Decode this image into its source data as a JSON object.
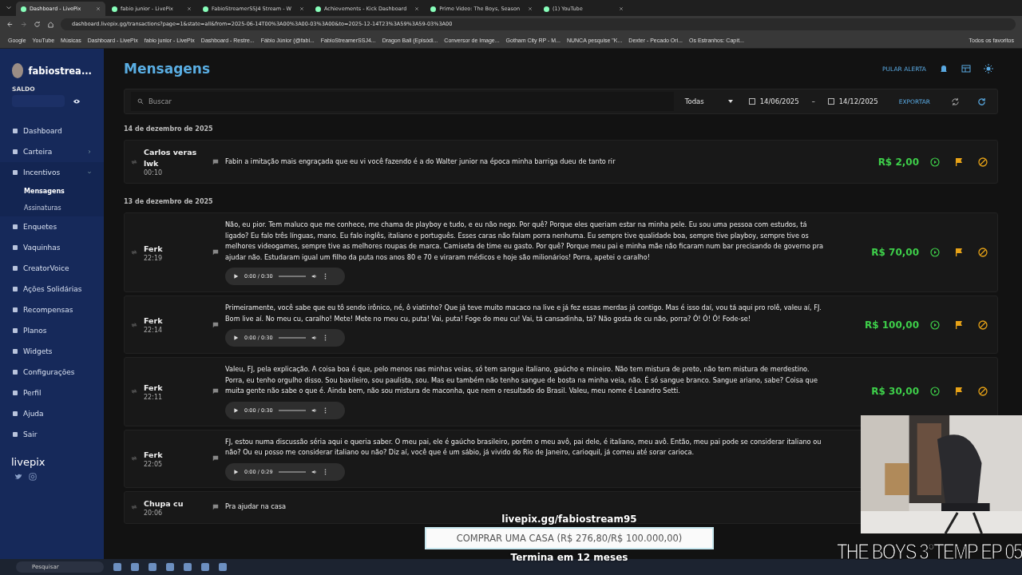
{
  "browser": {
    "tabs": [
      {
        "title": "Dashboard - LivePix",
        "selected": true
      },
      {
        "title": "fabio junior - LivePix",
        "selected": false
      },
      {
        "title": "FabioStreamerSSJ4 Stream - W",
        "selected": false
      },
      {
        "title": "Achievements - Kick Dashboard",
        "selected": false
      },
      {
        "title": "Prime Video: The Boys, Season",
        "selected": false
      },
      {
        "title": "(1) YouTube",
        "selected": false
      }
    ],
    "url": "dashboard.livepix.gg/transactions?page=1&state=all&from=2025-06-14T00%3A00%3A00-03%3A00&to=2025-12-14T23%3A59%3A59-03%3A00",
    "bookmarks": [
      "Google",
      "YouTube",
      "Músicas",
      "Dashboard - LivePix",
      "fabio junior - LivePix",
      "Dashboard - Restre...",
      "Fábio Júnior (@fabi...",
      "FabioStreamerSSJ4...",
      "Dragon Ball (Episódi...",
      "Conversor de Image...",
      "Gotham City RP - M...",
      "NUNCA pesquise \"K...",
      "Dexter - Pecado Ori...",
      "Os Estranhos: Capít..."
    ],
    "all_bookmarks": "Todos os favoritos"
  },
  "sidebar": {
    "user": "fabiostrea...",
    "balance_label": "SALDO",
    "logo": "livepix",
    "items": [
      {
        "label": "Dashboard",
        "selected": false
      },
      {
        "label": "Carteira",
        "selected": false,
        "expanded": false
      },
      {
        "label": "Incentivos",
        "selected": false,
        "expanded": true,
        "children": [
          {
            "label": "Mensagens",
            "selected": true
          },
          {
            "label": "Assinaturas",
            "selected": false
          }
        ]
      },
      {
        "label": "Enquetes",
        "selected": false
      },
      {
        "label": "Vaquinhas",
        "selected": false
      },
      {
        "label": "CreatorVoice",
        "selected": false
      },
      {
        "label": "Ações Solidárias",
        "selected": false
      },
      {
        "label": "Recompensas",
        "selected": false
      },
      {
        "label": "Planos",
        "selected": false
      },
      {
        "label": "Widgets",
        "selected": false
      },
      {
        "label": "Configurações",
        "selected": false
      },
      {
        "label": "Perfil",
        "selected": false
      },
      {
        "label": "Ajuda",
        "selected": false
      },
      {
        "label": "Sair",
        "selected": false
      }
    ]
  },
  "header": {
    "title": "Mensagens",
    "skip_alert": "PULAR ALERTA"
  },
  "filters": {
    "search_placeholder": "Buscar",
    "status": "Todas",
    "date_from": "14/06/2025",
    "date_to": "14/12/2025",
    "range_separator": "–",
    "export": "EXPORTAR"
  },
  "groups": [
    {
      "date": "14 de dezembro de 2025",
      "messages": [
        {
          "name": "Carlos veras lwk",
          "time": "00:10",
          "text": "Fabin a imitação mais engraçada que eu vi você fazendo é a do Walter junior na época minha barriga dueu de tanto rir",
          "amount": "R$ 2,00"
        }
      ]
    },
    {
      "date": "13 de dezembro de 2025",
      "messages": [
        {
          "name": "Ferk",
          "time": "22:19",
          "text": "Não, eu pior. Tem maluco que me conhece, me chama de playboy e tudo, e eu não nego. Por quê? Porque eles queriam estar na minha pele. Eu sou uma pessoa com estudos, tá ligado? Eu falo três línguas, mano. Eu falo inglês, italiano e português. Esses caras não falam porra nenhuma. Eu sempre tive qualidade boa, sempre tive playboy, sempre tive os melhores videogames, sempre tive as melhores roupas de marca. Camiseta de time eu gasto. Por quê? Porque meu pai e minha mãe não ficaram num bar precisando de governo pra ajudar não. Estudaram igual um filho da puta nos anos 80 e 70 e viraram médicos e hoje são milionários! Porra, apetei o caralho!",
          "audio": "0:00 / 0:30",
          "amount": "R$ 70,00"
        },
        {
          "name": "Ferk",
          "time": "22:14",
          "text": "Primeiramente, você sabe que eu tô sendo irônico, né, ô viatinho? Que já teve muito macaco na live e já fez essas merdas já contigo. Mas é isso daí, vou tá aqui pro rolê, valeu aí, FJ. Bom live aí. No meu cu, caralho! Mete! Mete no meu cu, puta! Vai, puta! Foge do meu cu! Vai, tá cansadinha, tá? Não gosta de cu não, porra? Ó! Ó! Ó! Fode-se!",
          "audio": "0:00 / 0:30",
          "amount": "R$ 100,00"
        },
        {
          "name": "Ferk",
          "time": "22:11",
          "text": "Valeu, FJ, pela explicação. A coisa boa é que, pelo menos nas minhas veias, só tem sangue italiano, gaúcho e mineiro. Não tem mistura de preto, não tem mistura de merdestino. Porra, eu tenho orgulho disso. Sou baxileiro, sou paulista, sou. Mas eu também não tenho sangue de bosta na minha veia, não. É só sangue branco. Sangue ariano, sabe? Coisa que muita gente não sabe o que é. Ainda bem, não sou mistura de maconha, que nem o resultado do Brasil. Valeu, meu nome é Leandro Setti.",
          "audio": "0:00 / 0:30",
          "amount": "R$ 30,00"
        },
        {
          "name": "Ferk",
          "time": "22:05",
          "text": "FJ, estou numa discussão séria aqui e queria saber. O meu pai, ele é gaúcho brasileiro, porém o meu avô, pai dele, é italiano, meu avô. Então, meu pai pode se considerar italiano ou não? Ou eu posso me considerar italiano ou não? Diz aí, você que é um sábio, já vivido do Rio de Janeiro, carioquil, já comeu até sorar carioca.",
          "audio": "0:00 / 0:29"
        },
        {
          "name": "Chupa cu",
          "time": "20:06",
          "text": "Pra ajudar na casa"
        }
      ]
    }
  ],
  "overlay": {
    "goal_url": "livepix.gg/fabiostream95",
    "goal": "COMPRAR UMA CASA (R$ 276,80/R$ 100.000,00)",
    "goal_ends": "Termina em 12 meses",
    "episode": "THE BOYS 3°TEMP EP 05"
  },
  "taskbar": {
    "search_placeholder": "Pesquisar"
  }
}
